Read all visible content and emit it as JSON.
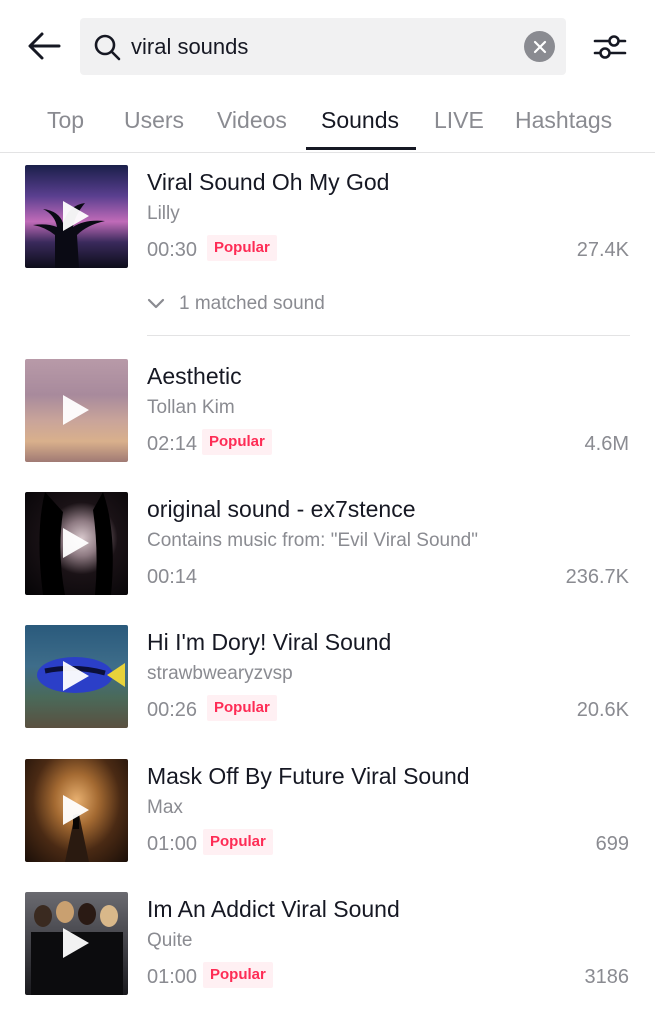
{
  "search": {
    "query": "viral sounds"
  },
  "tabs": [
    {
      "label": "Top"
    },
    {
      "label": "Users"
    },
    {
      "label": "Videos"
    },
    {
      "label": "Sounds",
      "active": true
    },
    {
      "label": "LIVE"
    },
    {
      "label": "Hashtags"
    }
  ],
  "colors": {
    "accent": "#fe2c55",
    "text": "#161823",
    "secondary": "#8a8b91",
    "badge_bg": "#fff0f3"
  },
  "sounds": [
    {
      "title": "Viral Sound Oh My God",
      "author": "Lilly",
      "duration": "00:30",
      "badge": "Popular",
      "count": "27.4K",
      "matched": "1 matched sound"
    },
    {
      "title": "Aesthetic",
      "author": "Tollan Kim",
      "duration": "02:14",
      "badge": "Popular",
      "count": "4.6M"
    },
    {
      "title": "original sound - ex7stence",
      "author": "Contains music from: \"Evil Viral Sound\"",
      "duration": "00:14",
      "badge": "",
      "count": "236.7K"
    },
    {
      "title": "Hi I'm Dory! Viral Sound",
      "author": "strawbwearyzvsp",
      "duration": "00:26",
      "badge": "Popular",
      "count": "20.6K"
    },
    {
      "title": "Mask Off By Future Viral Sound",
      "author": "Max",
      "duration": "01:00",
      "badge": "Popular",
      "count": "699"
    },
    {
      "title": "Im An Addict Viral Sound",
      "author": "Quite",
      "duration": "01:00",
      "badge": "Popular",
      "count": "3186"
    }
  ]
}
